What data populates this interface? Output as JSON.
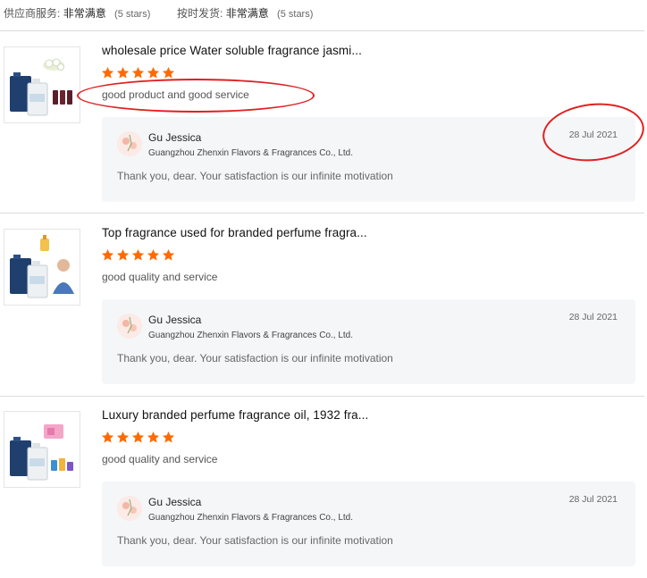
{
  "summary": {
    "supplier_service_label": "供应商服务:",
    "supplier_service_value": "非常满意",
    "supplier_service_stars": "(5 stars)",
    "ontime_label": "按时发货:",
    "ontime_value": "非常满意",
    "ontime_stars": "(5 stars)"
  },
  "reviews": [
    {
      "title": "wholesale price Water soluble fragrance jasmi...",
      "rating": 5,
      "comment": "good product and good service",
      "reply": {
        "name": "Gu Jessica",
        "company": "Guangzhou Zhenxin Flavors & Fragrances Co., Ltd.",
        "date": "28 Jul 2021",
        "text": "Thank you, dear. Your satisfaction is our infinite motivation"
      }
    },
    {
      "title": "Top fragrance used for branded perfume fragra...",
      "rating": 5,
      "comment": "good quality and service",
      "reply": {
        "name": "Gu Jessica",
        "company": "Guangzhou Zhenxin Flavors & Fragrances Co., Ltd.",
        "date": "28 Jul 2021",
        "text": "Thank you, dear. Your satisfaction is our infinite motivation"
      }
    },
    {
      "title": "Luxury branded perfume fragrance oil, 1932 fra...",
      "rating": 5,
      "comment": "good quality and service",
      "reply": {
        "name": "Gu Jessica",
        "company": "Guangzhou Zhenxin Flavors & Fragrances Co., Ltd.",
        "date": "28 Jul 2021",
        "text": "Thank you, dear. Your satisfaction is our infinite motivation"
      }
    }
  ],
  "colors": {
    "star": "#ff6a00",
    "annotation": "#e02020"
  }
}
